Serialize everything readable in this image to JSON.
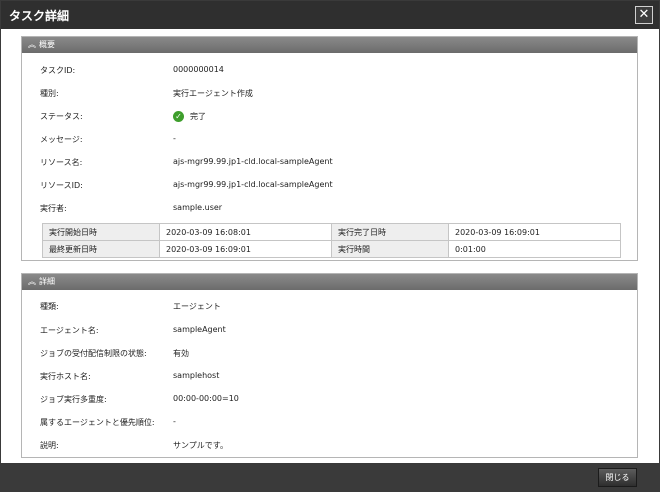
{
  "window": {
    "title": "タスク詳細",
    "close_glyph": "✕"
  },
  "overview": {
    "header": "概要",
    "fields": [
      {
        "label": "タスクID:",
        "value": "0000000014"
      },
      {
        "label": "種別:",
        "value": "実行エージェント作成"
      },
      {
        "label": "ステータス:",
        "value": "完了"
      },
      {
        "label": "メッセージ:",
        "value": "-"
      },
      {
        "label": "リソース名:",
        "value": "ajs-mgr99.99.jp1-cld.local-sampleAgent"
      },
      {
        "label": "リソースID:",
        "value": "ajs-mgr99.99.jp1-cld.local-sampleAgent"
      },
      {
        "label": "実行者:",
        "value": "sample.user"
      }
    ],
    "times": [
      {
        "label1": "実行開始日時",
        "value1": "2020-03-09 16:08:01",
        "label2": "実行完了日時",
        "value2": "2020-03-09 16:09:01"
      },
      {
        "label1": "最終更新日時",
        "value1": "2020-03-09 16:09:01",
        "label2": "実行時間",
        "value2": "0:01:00"
      }
    ]
  },
  "details": {
    "header": "詳細",
    "fields": [
      {
        "label": "種類:",
        "value": "エージェント"
      },
      {
        "label": "エージェント名:",
        "value": "sampleAgent"
      },
      {
        "label": "ジョブの受付配信制限の状態:",
        "value": "有効"
      },
      {
        "label": "実行ホスト名:",
        "value": "samplehost"
      },
      {
        "label": "ジョブ実行多重度:",
        "value": "00:00-00:00=10"
      },
      {
        "label": "属するエージェントと優先順位:",
        "value": "-"
      },
      {
        "label": "説明:",
        "value": "サンプルです。"
      }
    ]
  },
  "footer": {
    "close_label": "閉じる"
  },
  "icons": {
    "status": "check-circle-icon",
    "collapse": "chevron-up-icon"
  }
}
